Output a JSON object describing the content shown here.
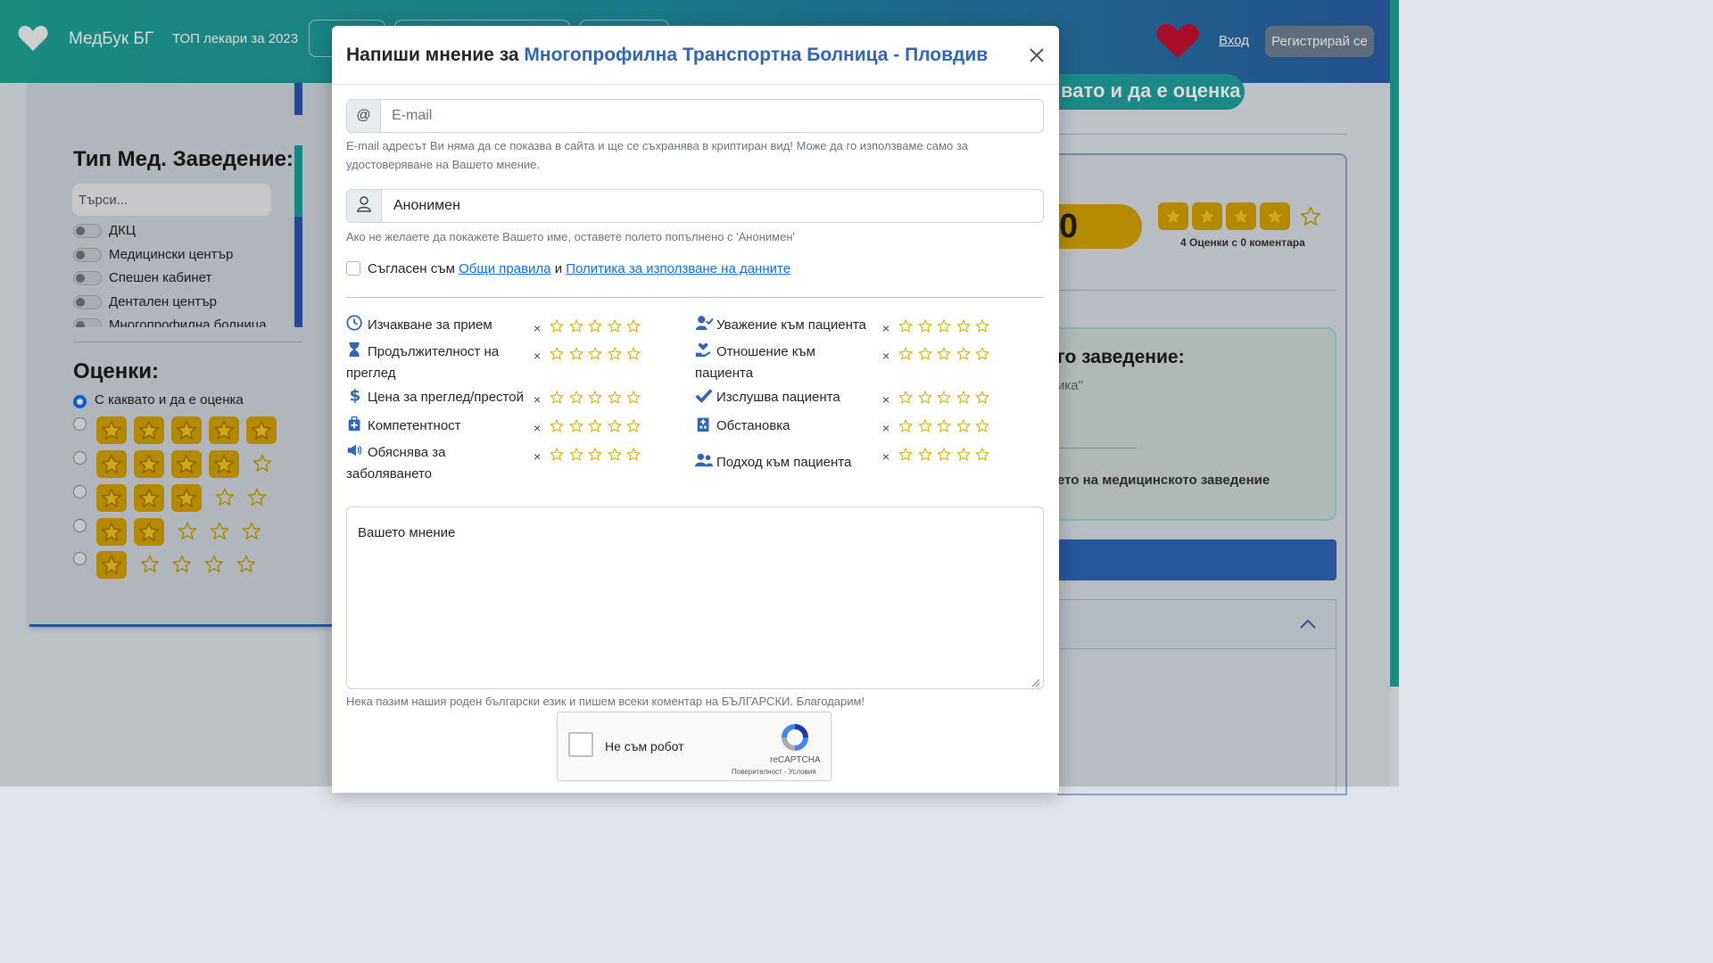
{
  "header": {
    "logo_text": "МедБук БГ",
    "top_link": "ТОП лекари за 2023",
    "login": "Вход",
    "register": "Регистрирай се"
  },
  "sidebar": {
    "type_title": "Тип Мед. Заведение:",
    "search_placeholder": "Търси...",
    "types": [
      "ДКЦ",
      "Медицински център",
      "Спешен кабинет",
      "Дентален център",
      "Многопрофилна болница"
    ],
    "ratings_title": "Оценки:",
    "rating_any": "С каквато и да е оценка",
    "rating_filters": [
      5,
      4,
      3,
      2,
      1
    ]
  },
  "background": {
    "pill_text": "вато и да е оценка",
    "score_text": "0",
    "stars_filled": 4,
    "count_text": "4 Оценки с 0 коментара",
    "inner_title": "го заведение:",
    "inner_sub": "ика\"",
    "inner_bold": "ето на медицинското заведение"
  },
  "modal": {
    "title_prefix": "Напиши мнение за",
    "hospital_name": "Многопрофилна Транспортна Болница - Пловдив",
    "email": {
      "addon": "@",
      "placeholder": "E-mail",
      "value": "",
      "help": "E-mail адресът Ви няма да се показва в сайта и ще се съхранява в криптиран вид! Може да го използваме само за удостоверяване на Вашето мнение."
    },
    "name": {
      "value": "Анонимен",
      "help": "Ако не желаете да покажете Вашето име, оставете полето попълнено с 'Анонимен'"
    },
    "agree": {
      "prefix": "Съгласен съм",
      "rules_link": "Общи правила",
      "and": "и",
      "policy_link": "Политика за използване на данните"
    },
    "criteria_left": [
      {
        "icon": "clock-icon",
        "label": "Изчакване за прием",
        "rating": 0
      },
      {
        "icon": "hourglass-icon",
        "label": "Продължителност на преглед",
        "rating": 0
      },
      {
        "icon": "dollar-icon",
        "label": "Цена за преглед/престой",
        "rating": 0
      },
      {
        "icon": "medkit-icon",
        "label": "Компетентност",
        "rating": 0
      },
      {
        "icon": "megaphone-icon",
        "label": "Обяснява за заболяването",
        "rating": 0
      }
    ],
    "criteria_right": [
      {
        "icon": "user-check-icon",
        "label": "Уважение към пациента",
        "rating": 0
      },
      {
        "icon": "hand-heart-icon",
        "label": "Отношение към пациента",
        "rating": 0
      },
      {
        "icon": "check-icon",
        "label": "Изслушва пациента",
        "rating": 0
      },
      {
        "icon": "hospital-icon",
        "label": "Обстановка",
        "rating": 0
      },
      {
        "icon": "users-icon",
        "label": "Подход към пациента",
        "rating": 0
      }
    ],
    "clear_symbol": "×",
    "opinion_placeholder": "Вашето мнение",
    "language_note": "Нека пазим нашия роден български език и пишем всеки коментар на БЪЛГАРСКИ. Благодарим!",
    "captcha": {
      "label": "Не съм робот",
      "brand": "reCAPTCHA",
      "terms": "Поверителност - Условия"
    }
  },
  "colors": {
    "brand_teal": "#1fa596",
    "brand_blue": "#2f65b8",
    "star_gold": "#e0b000",
    "link_blue": "#0d6efd"
  }
}
